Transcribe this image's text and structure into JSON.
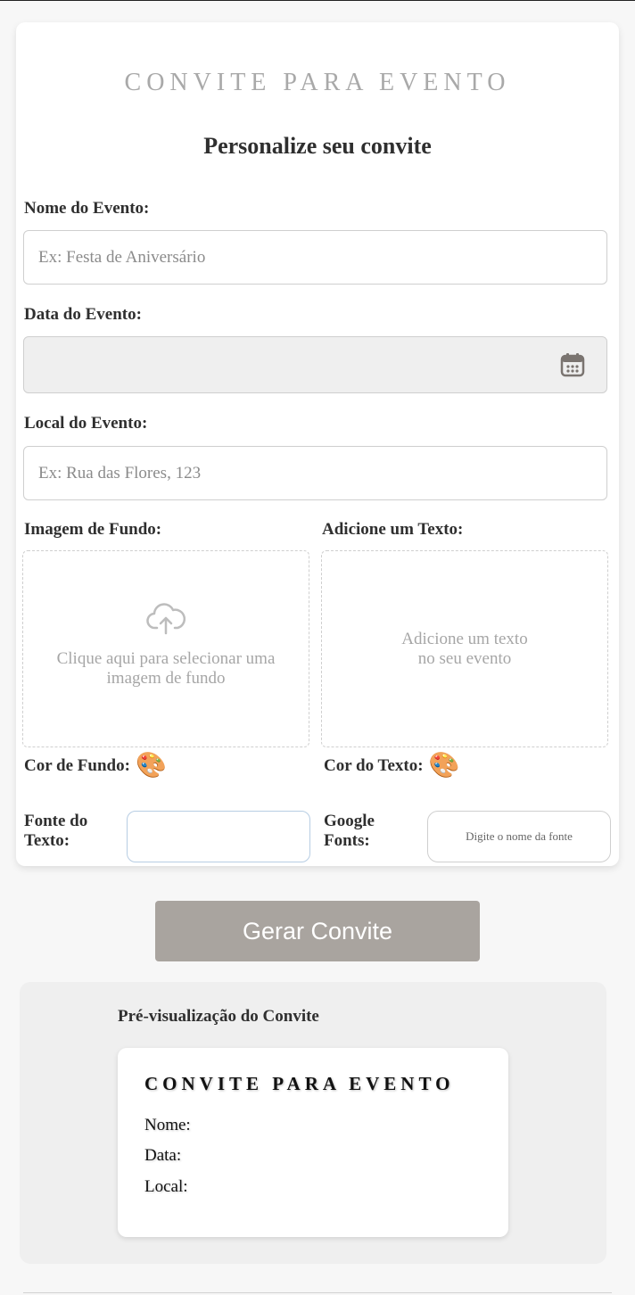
{
  "header": {
    "title": "CONVITE PARA EVENTO",
    "subtitle": "Personalize seu convite"
  },
  "form": {
    "event_name": {
      "label": "Nome do Evento:",
      "placeholder": "Ex: Festa de Aniversário",
      "value": ""
    },
    "event_date": {
      "label": "Data do Evento:",
      "value": "",
      "icon": "calendar-icon"
    },
    "event_location": {
      "label": "Local do Evento:",
      "placeholder": "Ex: Rua das Flores, 123",
      "value": ""
    },
    "background_image": {
      "label": "Imagem de Fundo:",
      "prompt": "Clique aqui para selecionar uma imagem de fundo",
      "icon": "cloud-upload-icon"
    },
    "custom_text": {
      "label": "Adicione um Texto:",
      "placeholder": "Adicione um texto no seu evento"
    },
    "background_color": {
      "label": "Cor de Fundo:",
      "icon": "palette-icon"
    },
    "text_color": {
      "label": "Cor do Texto:",
      "icon": "palette-icon"
    },
    "text_font": {
      "label": "Fonte do Texto:",
      "value": ""
    },
    "google_fonts": {
      "label": "Google Fonts:",
      "placeholder": "Digite o nome da fonte"
    }
  },
  "actions": {
    "generate_label": "Gerar Convite",
    "generate_color": "#a9a49f"
  },
  "preview": {
    "heading": "Pré-visualização do Convite",
    "card_title": "CONVITE PARA EVENTO",
    "name_label": "Nome:",
    "date_label": "Data:",
    "location_label": "Local:"
  }
}
